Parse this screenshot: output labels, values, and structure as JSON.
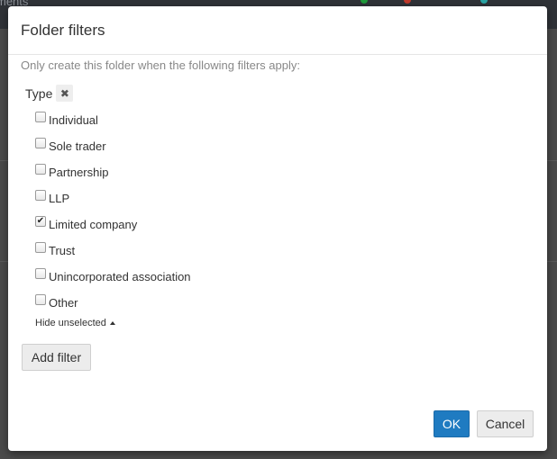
{
  "backdrop": {
    "text": "ments",
    "accent_colors": [
      "#1f9a3a",
      "#c0392b",
      "#2aa4a4"
    ]
  },
  "dialog": {
    "title": "Folder filters",
    "hint": "Only create this folder when the following filters apply:",
    "filter_type_label": "Type",
    "remove_icon": "close-icon",
    "remove_glyph": "✖",
    "options": [
      {
        "label": "Individual",
        "checked": false
      },
      {
        "label": "Sole trader",
        "checked": false
      },
      {
        "label": "Partnership",
        "checked": false
      },
      {
        "label": "LLP",
        "checked": false
      },
      {
        "label": "Limited company",
        "checked": true
      },
      {
        "label": "Trust",
        "checked": false
      },
      {
        "label": "Unincorporated association",
        "checked": false
      },
      {
        "label": "Other",
        "checked": false
      }
    ],
    "hide_unselected_label": "Hide unselected",
    "add_filter_label": "Add filter",
    "ok_label": "OK",
    "cancel_label": "Cancel",
    "colors": {
      "primary": "#1f7bc1",
      "hint": "#888888"
    }
  }
}
